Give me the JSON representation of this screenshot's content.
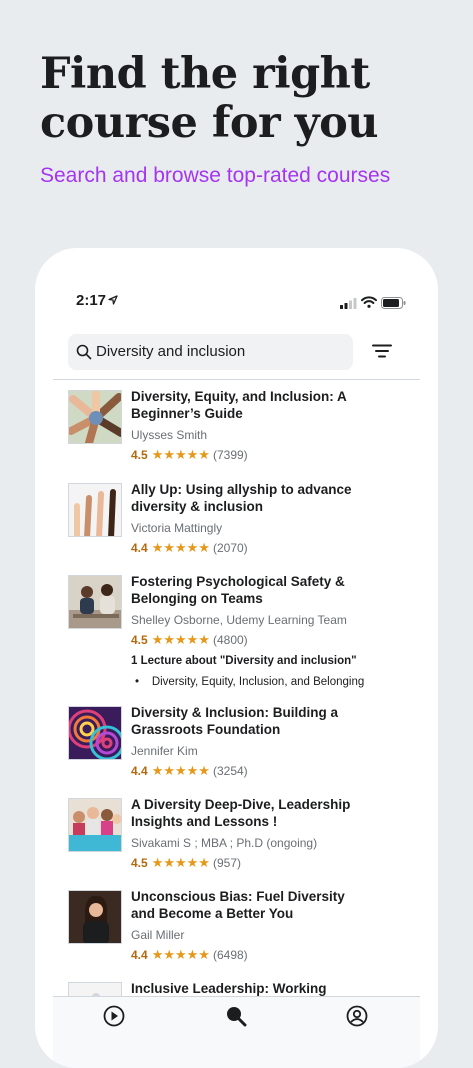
{
  "headline": {
    "line1": "Find the right",
    "line2": "course for you"
  },
  "subheadline": "Search and browse top-rated courses",
  "status_bar": {
    "time": "2:17"
  },
  "search": {
    "value": "Diversity and inclusion"
  },
  "courses": [
    {
      "title": "Diversity, Equity, and Inclusion: A Beginner’s Guide",
      "author": "Ulysses Smith",
      "rating": "4.5",
      "stars": "★★★★★",
      "reviews": "(7399)"
    },
    {
      "title": "Ally Up: Using allyship to advance diversity & inclusion",
      "author": "Victoria Mattingly",
      "rating": "4.4",
      "stars": "★★★★★",
      "reviews": "(2070)"
    },
    {
      "title": "Fostering Psychological Safety & Belonging on Teams",
      "author": "Shelley Osborne, Udemy Learning Team",
      "rating": "4.5",
      "stars": "★★★★★",
      "reviews": "(4800)",
      "lecture_match": "1 Lecture about \"Diversity and inclusion\"",
      "lecture_item": "Diversity, Equity, Inclusion, and Belonging"
    },
    {
      "title": "Diversity & Inclusion: Building a Grassroots Foundation",
      "author": "Jennifer Kim",
      "rating": "4.4",
      "stars": "★★★★★",
      "reviews": "(3254)"
    },
    {
      "title": "A Diversity Deep-Dive, Leadership Insights and Lessons !",
      "author": "Sivakami S ; MBA ; Ph.D (ongoing)",
      "rating": "4.5",
      "stars": "★★★★★",
      "reviews": "(957)"
    },
    {
      "title": "Unconscious Bias: Fuel Diversity and Become a Better You",
      "author": "Gail Miller",
      "rating": "4.4",
      "stars": "★★★★★",
      "reviews": "(6498)"
    },
    {
      "title": "Inclusive Leadership: Working with"
    }
  ],
  "tabbar": {
    "icons": [
      "play-icon",
      "search-icon",
      "account-icon"
    ]
  },
  "colors": {
    "accent": "#a435f0",
    "rating": "#b4690e",
    "star": "#e59819",
    "background": "#e9ecef"
  }
}
